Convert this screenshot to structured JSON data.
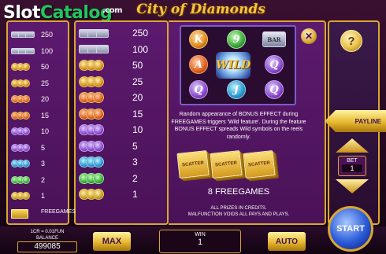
{
  "logo": {
    "slot": "Slot",
    "catalog": "Catalog",
    "com": ".com"
  },
  "game_title": "City of Diamonds",
  "paytable_left": [
    {
      "symbol": "bar-icon",
      "value": "250"
    },
    {
      "symbol": "bar-icon",
      "value": "100"
    },
    {
      "symbol": "seven-icon",
      "value": "50"
    },
    {
      "symbol": "seven-icon",
      "value": "25"
    },
    {
      "symbol": "ace-icon",
      "value": "20"
    },
    {
      "symbol": "king-icon",
      "value": "15"
    },
    {
      "symbol": "queen-icon",
      "value": "10"
    },
    {
      "symbol": "queen-icon",
      "value": "5"
    },
    {
      "symbol": "jack-icon",
      "value": "3"
    },
    {
      "symbol": "ten-icon",
      "value": "2"
    },
    {
      "symbol": "nine-icon",
      "value": "1"
    }
  ],
  "freegames_row_label": "FREEGAMES",
  "paytable_mid": [
    {
      "symbol": "bar-icon",
      "value": "250"
    },
    {
      "symbol": "bar-icon",
      "value": "100"
    },
    {
      "symbol": "seven-icon",
      "value": "50"
    },
    {
      "symbol": "seven-icon",
      "value": "25"
    },
    {
      "symbol": "ace-icon",
      "value": "20"
    },
    {
      "symbol": "king-icon",
      "value": "15"
    },
    {
      "symbol": "queen-icon",
      "value": "10"
    },
    {
      "symbol": "queen-icon",
      "value": "5"
    },
    {
      "symbol": "jack-icon",
      "value": "3"
    },
    {
      "symbol": "ten-icon",
      "value": "2"
    },
    {
      "symbol": "nine-icon",
      "value": "1"
    }
  ],
  "reel_preview": {
    "wild_label": "WILD",
    "symbols": [
      "K",
      "9",
      "BAR",
      "A",
      "",
      "Q",
      "Q",
      "J",
      "Q"
    ]
  },
  "description": "Random appearance of BONUS EFFECT during FREEGAMES triggers 'Wild feature'. During the feature BONUS EFFECT spreads Wild symbols on the reels randomly.",
  "scatter_label": "SCATTER",
  "freegames_text": "8 FREEGAMES",
  "notes": {
    "line1": "ALL PRIZES IN CREDITS.",
    "line2": "MALFUNCTION VOIDS ALL PAYS AND PLAYS."
  },
  "controls": {
    "close": "✕",
    "help": "?",
    "payline": "PAYLINE",
    "bet_label": "BET",
    "bet_value": "1",
    "start": "START",
    "max": "MAX",
    "auto": "AUTO",
    "win_label": "WIN",
    "win_value": "1"
  },
  "credit": {
    "rate": "1CR = 0.01FUN",
    "balance_label": "BALANCE",
    "balance_value": "499085"
  },
  "colors": {
    "panel_purple": "#5c1a6e",
    "gold_border": "#d9a632",
    "start_blue": "#2a5ad8",
    "logo_green": "#22c55e"
  }
}
